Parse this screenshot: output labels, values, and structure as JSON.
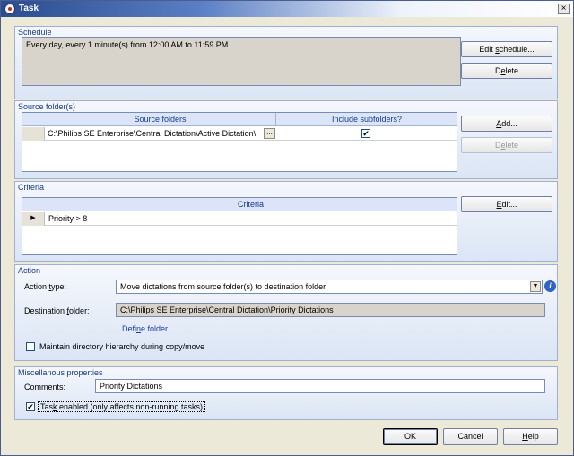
{
  "window": {
    "title": "Task",
    "close_glyph": "×"
  },
  "schedule": {
    "title": "Schedule",
    "text": "Every day, every 1 minute(s) from 12:00 AM to 11:59 PM",
    "edit_label_pre": "Edit ",
    "edit_label_u": "s",
    "edit_label_post": "chedule...",
    "delete_label_pre": "D",
    "delete_label_u": "e",
    "delete_label_post": "lete"
  },
  "source": {
    "title": "Source folder(s)",
    "columns": [
      "Source folders",
      "Include subfolders?"
    ],
    "rows": [
      {
        "path": "C:\\Philips SE Enterprise\\Central Dictation\\Active Dictation\\",
        "include": true,
        "check_glyph": "✔",
        "browse": "..."
      }
    ],
    "add_label_u": "A",
    "add_label_post": "dd...",
    "delete_label_pre": "D",
    "delete_label_u": "e",
    "delete_label_post": "lete"
  },
  "criteria": {
    "title": "Criteria",
    "column": "Criteria",
    "rows": [
      {
        "value": "Priority > 8"
      }
    ],
    "row_marker": "▶",
    "edit_label_u": "E",
    "edit_label_post": "dit..."
  },
  "action": {
    "title": "Action",
    "type_label_pre": "Action ",
    "type_label_u": "t",
    "type_label_post": "ype:",
    "type_value": "Move dictations from source folder(s) to destination folder",
    "dest_label_pre": "Destination ",
    "dest_label_u": "f",
    "dest_label_post": "older:",
    "dest_value": "C:\\Philips SE Enterprise\\Central Dictation\\Priority Dictations",
    "define_pre": "Defi",
    "define_u": "n",
    "define_post": "e folder...",
    "maintain_label": "Maintain directory hierarchy during copy/move",
    "maintain_checked": false,
    "dropdown_glyph": "▼",
    "info_glyph": "i"
  },
  "misc": {
    "title": "Miscellanous properties",
    "comments_pre": "Co",
    "comments_u": "m",
    "comments_post": "ments:",
    "comments_value": "Priority Dictations",
    "enabled_pre": "Tas",
    "enabled_u": "k",
    "enabled_post": " enabled (only affects non-running tasks)",
    "enabled_checked": true,
    "check_glyph": "✔"
  },
  "footer": {
    "ok_label": "OK",
    "cancel_label": "Cancel",
    "help_u": "H",
    "help_post": "elp"
  },
  "colors": {
    "accent": "#1a3a8a",
    "title_bar": "#2b4c8e",
    "readonly_bg": "#d8d3cb"
  }
}
